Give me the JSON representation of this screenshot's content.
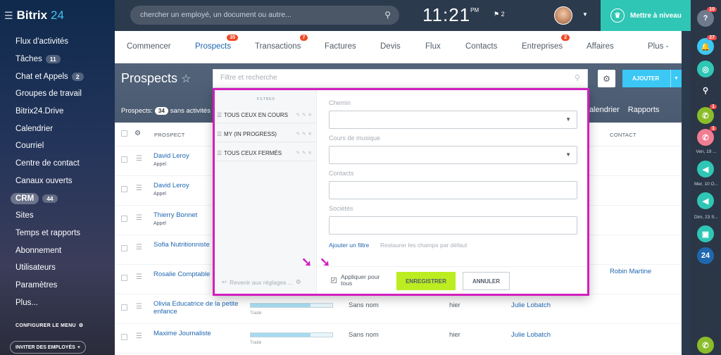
{
  "app": {
    "logo_word": "Bitrix",
    "logo_num": "24"
  },
  "sidebar": {
    "items": [
      {
        "label": "Flux d'activités",
        "count": ""
      },
      {
        "label": "Tâches",
        "count": "11"
      },
      {
        "label": "Chat et Appels",
        "count": "2"
      },
      {
        "label": "Groupes de travail",
        "count": ""
      },
      {
        "label": "Bitrix24.Drive",
        "count": ""
      },
      {
        "label": "Calendrier",
        "count": ""
      },
      {
        "label": "Courriel",
        "count": ""
      },
      {
        "label": "Centre de contact",
        "count": ""
      },
      {
        "label": "Canaux ouverts",
        "count": ""
      },
      {
        "label": "CRM",
        "count": "44"
      },
      {
        "label": "Sites",
        "count": ""
      },
      {
        "label": "Temps et rapports",
        "count": ""
      },
      {
        "label": "Abonnement",
        "count": ""
      },
      {
        "label": "Utilisateurs",
        "count": ""
      },
      {
        "label": "Paramètres",
        "count": ""
      },
      {
        "label": "Plus...",
        "count": ""
      }
    ],
    "configure_menu": "CONFIGURER LE MENU",
    "invite_label": "INVITER DES EMPLOYÉS",
    "invite_plus": "+"
  },
  "header": {
    "search_placeholder": "chercher un employé, un document ou autre...",
    "clock": "11:21",
    "clock_suffix": "PM",
    "flag_count": "2",
    "upgrade_label": "Mettre à niveau"
  },
  "tabs": [
    {
      "label": "Commencer",
      "badge": ""
    },
    {
      "label": "Prospects",
      "badge": "35"
    },
    {
      "label": "Transactions",
      "badge": "7"
    },
    {
      "label": "Factures",
      "badge": ""
    },
    {
      "label": "Devis",
      "badge": ""
    },
    {
      "label": "Flux",
      "badge": ""
    },
    {
      "label": "Contacts",
      "badge": ""
    },
    {
      "label": "Entreprises",
      "badge": "2"
    },
    {
      "label": "Affaires",
      "badge": ""
    },
    {
      "label": "Plus -",
      "badge": ""
    }
  ],
  "page": {
    "title": "Prospects",
    "add_label": "AJOUTER",
    "count_prefix": "Prospects:",
    "count": "34",
    "count_suffix": "sans activités",
    "calendar_link": "Calendrier",
    "reports_link": "Rapports"
  },
  "grid": {
    "headers": {
      "prospect": "PROSPECT",
      "contact": "CONTACT"
    },
    "rows": [
      {
        "name": "David Leroy",
        "sub": "Appel",
        "status": "",
        "created": "",
        "by": "",
        "contact": ""
      },
      {
        "name": "David Leroy",
        "sub": "Appel",
        "status": "",
        "created": "",
        "by": "",
        "contact": ""
      },
      {
        "name": "Thierry Bonnet",
        "sub": "Appel",
        "status": "",
        "created": "",
        "by": "",
        "contact": ""
      },
      {
        "name": "Sofia Nutritionniste",
        "sub": "",
        "status": "",
        "created": "",
        "by": "",
        "contact": ""
      },
      {
        "name": "Rosalie Comptable",
        "sub": "",
        "status": "",
        "created": "",
        "by": "",
        "contact": "Robin Martine"
      },
      {
        "name": "Olivia Educatrice de la petite enfance",
        "sub": "",
        "status": "Traité",
        "progress": 0.73,
        "nom": "Sans nom",
        "created": "hier",
        "by": "Julie Lobatch",
        "contact": ""
      },
      {
        "name": "Maxime Journaliste",
        "sub": "",
        "status": "Traité",
        "progress": 0.73,
        "nom": "Sans nom",
        "created": "hier",
        "by": "Julie Lobatch",
        "contact": ""
      }
    ]
  },
  "filter": {
    "search_placeholder": "Filtre et recherche",
    "presets_title": "FILTRES",
    "presets": [
      {
        "label": "TOUS CEUX EN COURS"
      },
      {
        "label": "MY (IN PROGRESS)"
      },
      {
        "label": "TOUS CEUX FERMÉS"
      }
    ],
    "reset_label": "Revenir aux réglages ...",
    "fields": [
      {
        "label": "Chemin",
        "type": "select"
      },
      {
        "label": "Cours de musique",
        "type": "select"
      },
      {
        "label": "Contacts",
        "type": "text"
      },
      {
        "label": "Sociétés",
        "type": "text"
      }
    ],
    "add_filter": "Ajouter un filtre",
    "restore_fields": "Restaurer les champs par défaut",
    "apply_all": "Appliquer pour tous",
    "apply_checked": true,
    "save": "ENREGISTRER",
    "cancel": "ANNULER"
  },
  "rightbar": {
    "help_badge": "10",
    "notif_badge": "27",
    "call_badge_1": "1",
    "call_badge_2": "1",
    "date1": "Ven, 19 ...",
    "date2": "Mer, 10 O...",
    "date3": "Dim, 23 S...",
    "b24": "24"
  },
  "colors": {
    "accent": "#2067b0",
    "highlight": "#d31fbe",
    "save": "#bbed21",
    "upgrade": "#2fc6b5"
  }
}
